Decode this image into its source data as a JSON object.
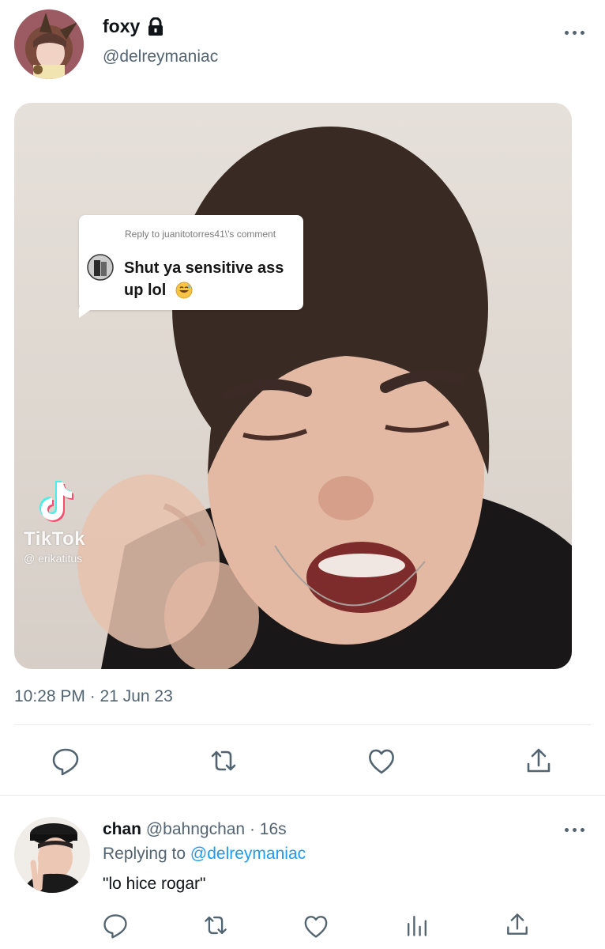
{
  "tweet": {
    "display_name": "foxy",
    "handle": "@delreymaniac",
    "timestamp": "10:28 PM · 21 Jun 23",
    "media": {
      "overlay_reply_to": "Reply to juanitotorres41\\'s comment",
      "overlay_comment": "Shut ya sensitive ass up lol",
      "tiktok_wordmark": "TikTok",
      "tiktok_username": "@ erikatitus"
    },
    "actions": [
      "reply-icon",
      "retweet-icon",
      "like-icon",
      "share-icon"
    ]
  },
  "reply": {
    "display_name": "chan",
    "handle": "@bahngchan",
    "separator": " · ",
    "time": "16s",
    "replying_prefix": "Replying to ",
    "replying_handle": "@delreymaniac",
    "text": "\"lo hice rogar\"",
    "actions": [
      "reply-icon",
      "retweet-icon",
      "like-icon",
      "views-icon",
      "share-icon"
    ]
  },
  "colors": {
    "text_primary": "#0f1419",
    "text_secondary": "#536471",
    "link": "#1d9bf0",
    "divider": "#e7eaed"
  }
}
